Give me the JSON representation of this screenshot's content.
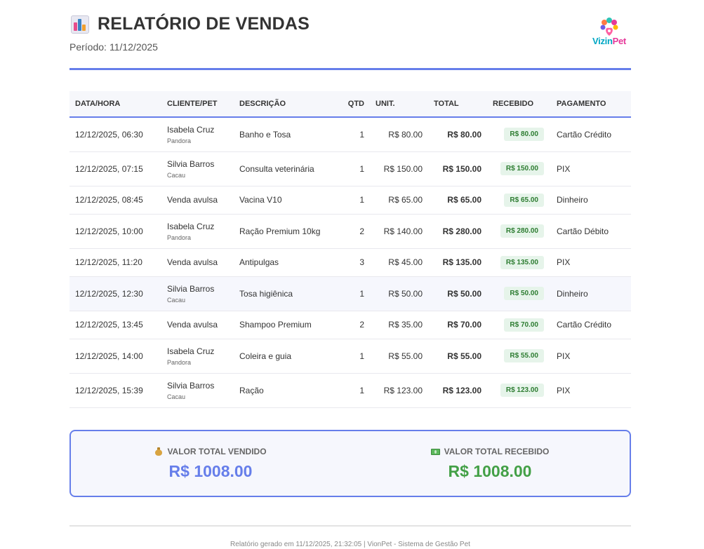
{
  "header": {
    "title": "RELATÓRIO DE VENDAS",
    "title_icon": "bar-chart-icon",
    "period_label": "Período:",
    "period_value": "11/12/2025",
    "logo": {
      "part1": "Vizin",
      "part2": "Pet",
      "icon": "paw-icon"
    }
  },
  "table": {
    "columns": [
      "DATA/HORA",
      "CLIENTE/PET",
      "DESCRIÇÃO",
      "QTD",
      "UNIT.",
      "TOTAL",
      "RECEBIDO",
      "PAGAMENTO"
    ],
    "rows": [
      {
        "datetime": "12/12/2025, 06:30",
        "client": "Isabela Cruz",
        "pet": "Pandora",
        "description": "Banho e Tosa",
        "qty": "1",
        "unit": "R$ 80.00",
        "total": "R$ 80.00",
        "received": "R$ 80.00",
        "payment": "Cartão Crédito"
      },
      {
        "datetime": "12/12/2025, 07:15",
        "client": "Silvia Barros",
        "pet": "Cacau",
        "description": "Consulta veterinária",
        "qty": "1",
        "unit": "R$ 150.00",
        "total": "R$ 150.00",
        "received": "R$ 150.00",
        "payment": "PIX"
      },
      {
        "datetime": "12/12/2025, 08:45",
        "client": "Venda avulsa",
        "pet": "",
        "description": "Vacina V10",
        "qty": "1",
        "unit": "R$ 65.00",
        "total": "R$ 65.00",
        "received": "R$ 65.00",
        "payment": "Dinheiro"
      },
      {
        "datetime": "12/12/2025, 10:00",
        "client": "Isabela Cruz",
        "pet": "Pandora",
        "description": "Ração Premium 10kg",
        "qty": "2",
        "unit": "R$ 140.00",
        "total": "R$ 280.00",
        "received": "R$ 280.00",
        "payment": "Cartão Débito"
      },
      {
        "datetime": "12/12/2025, 11:20",
        "client": "Venda avulsa",
        "pet": "",
        "description": "Antipulgas",
        "qty": "3",
        "unit": "R$ 45.00",
        "total": "R$ 135.00",
        "received": "R$ 135.00",
        "payment": "PIX"
      },
      {
        "datetime": "12/12/2025, 12:30",
        "client": "Silvia Barros",
        "pet": "Cacau",
        "description": "Tosa higiênica",
        "qty": "1",
        "unit": "R$ 50.00",
        "total": "R$ 50.00",
        "received": "R$ 50.00",
        "payment": "Dinheiro"
      },
      {
        "datetime": "12/12/2025, 13:45",
        "client": "Venda avulsa",
        "pet": "",
        "description": "Shampoo Premium",
        "qty": "2",
        "unit": "R$ 35.00",
        "total": "R$ 70.00",
        "received": "R$ 70.00",
        "payment": "Cartão Crédito"
      },
      {
        "datetime": "12/12/2025, 14:00",
        "client": "Isabela Cruz",
        "pet": "Pandora",
        "description": "Coleira e guia",
        "qty": "1",
        "unit": "R$ 55.00",
        "total": "R$ 55.00",
        "received": "R$ 55.00",
        "payment": "PIX"
      },
      {
        "datetime": "12/12/2025, 15:39",
        "client": "Silvia Barros",
        "pet": "Cacau",
        "description": "Ração",
        "qty": "1",
        "unit": "R$ 123.00",
        "total": "R$ 123.00",
        "received": "R$ 123.00",
        "payment": "PIX"
      }
    ]
  },
  "summary": {
    "sold_label": "VALOR TOTAL VENDIDO",
    "sold_icon": "money-bag-icon",
    "sold_value": "R$ 1008.00",
    "received_label": "VALOR TOTAL RECEBIDO",
    "received_icon": "dollar-bill-icon",
    "received_value": "R$ 1008.00"
  },
  "footer": {
    "text": "Relatório gerado em 11/12/2025, 21:32:05 | VionPet - Sistema de Gestão Pet"
  },
  "colors": {
    "accent": "#667eea",
    "received_green": "#43a047",
    "badge_bg": "#e6f4ea",
    "badge_text": "#2e7d32"
  }
}
